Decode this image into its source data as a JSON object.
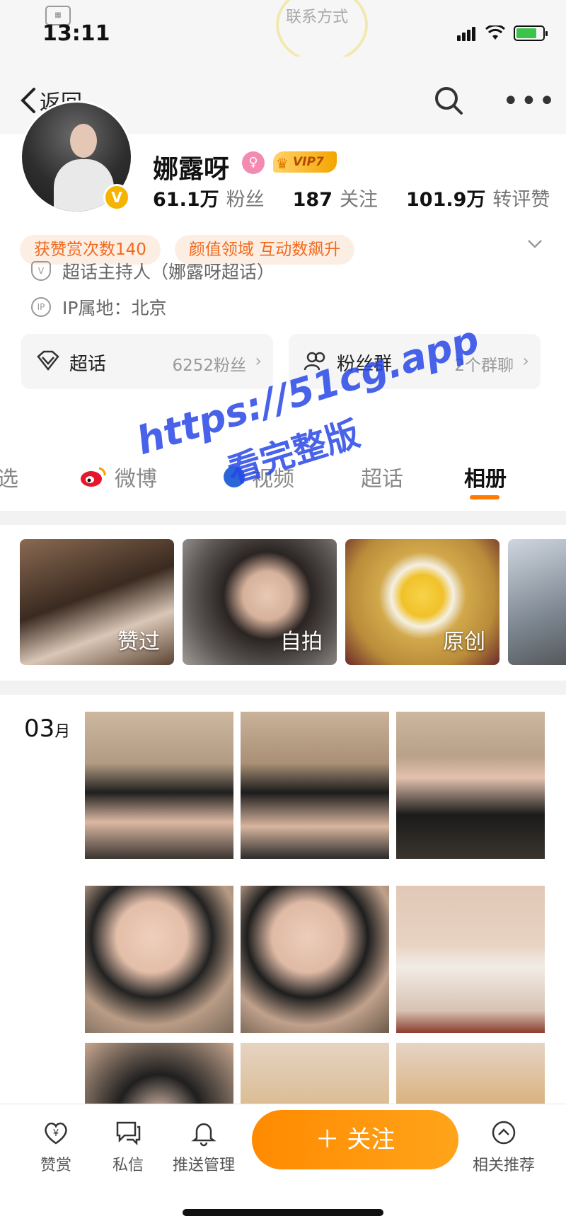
{
  "status_bar": {
    "time": "13:11",
    "contact_label": "联系方式",
    "signal_bars": 4,
    "battery_level": 0.7
  },
  "nav": {
    "back_label": "返回",
    "icons": [
      "chevron-left-icon",
      "search-icon",
      "more-icon"
    ]
  },
  "profile": {
    "name": "娜露呀",
    "verified_badge": "V",
    "vip_label": "VIP7",
    "stats": [
      {
        "value": "61.1万",
        "label": "粉丝"
      },
      {
        "value": "187",
        "label": "关注"
      },
      {
        "value": "101.9万",
        "label": "转评赞"
      }
    ],
    "tags": [
      "获赞赏次数140",
      "颜值领域 互动数飙升"
    ],
    "info": [
      {
        "icon": "shield-icon",
        "text": "超话主持人（娜露呀超话）"
      },
      {
        "icon": "ip-icon",
        "text": "IP属地：北京"
      }
    ],
    "cards": [
      {
        "icon": "diamond-icon",
        "title": "超话",
        "subtitle": "6252粉丝"
      },
      {
        "icon": "group-icon",
        "title": "粉丝群",
        "subtitle": "2个群聊"
      }
    ]
  },
  "tabs": [
    {
      "label": "选",
      "active": false
    },
    {
      "label": "微博",
      "active": false
    },
    {
      "label": "视频",
      "active": false
    },
    {
      "label": "超话",
      "active": false
    },
    {
      "label": "相册",
      "active": true
    }
  ],
  "albums": [
    {
      "label": "赞过"
    },
    {
      "label": "自拍"
    },
    {
      "label": "原创"
    },
    {
      "label": ""
    }
  ],
  "photos": {
    "month_num": "03",
    "month_unit": "月",
    "count_visible": 9
  },
  "watermark": {
    "line1": "https://51cg.app",
    "line2": "看完整版"
  },
  "bottom_bar": {
    "items": [
      {
        "icon": "reward-icon",
        "label": "赞赏"
      },
      {
        "icon": "message-icon",
        "label": "私信"
      },
      {
        "icon": "bell-icon",
        "label": "推送管理"
      },
      {
        "icon": "recommend-icon",
        "label": "相关推荐"
      }
    ],
    "follow_label": "＋ 关注"
  },
  "colors": {
    "accent": "#ff8a00",
    "tag_text": "#f06a1e",
    "tag_bg": "#fdeee3",
    "watermark": "#2846e6"
  }
}
